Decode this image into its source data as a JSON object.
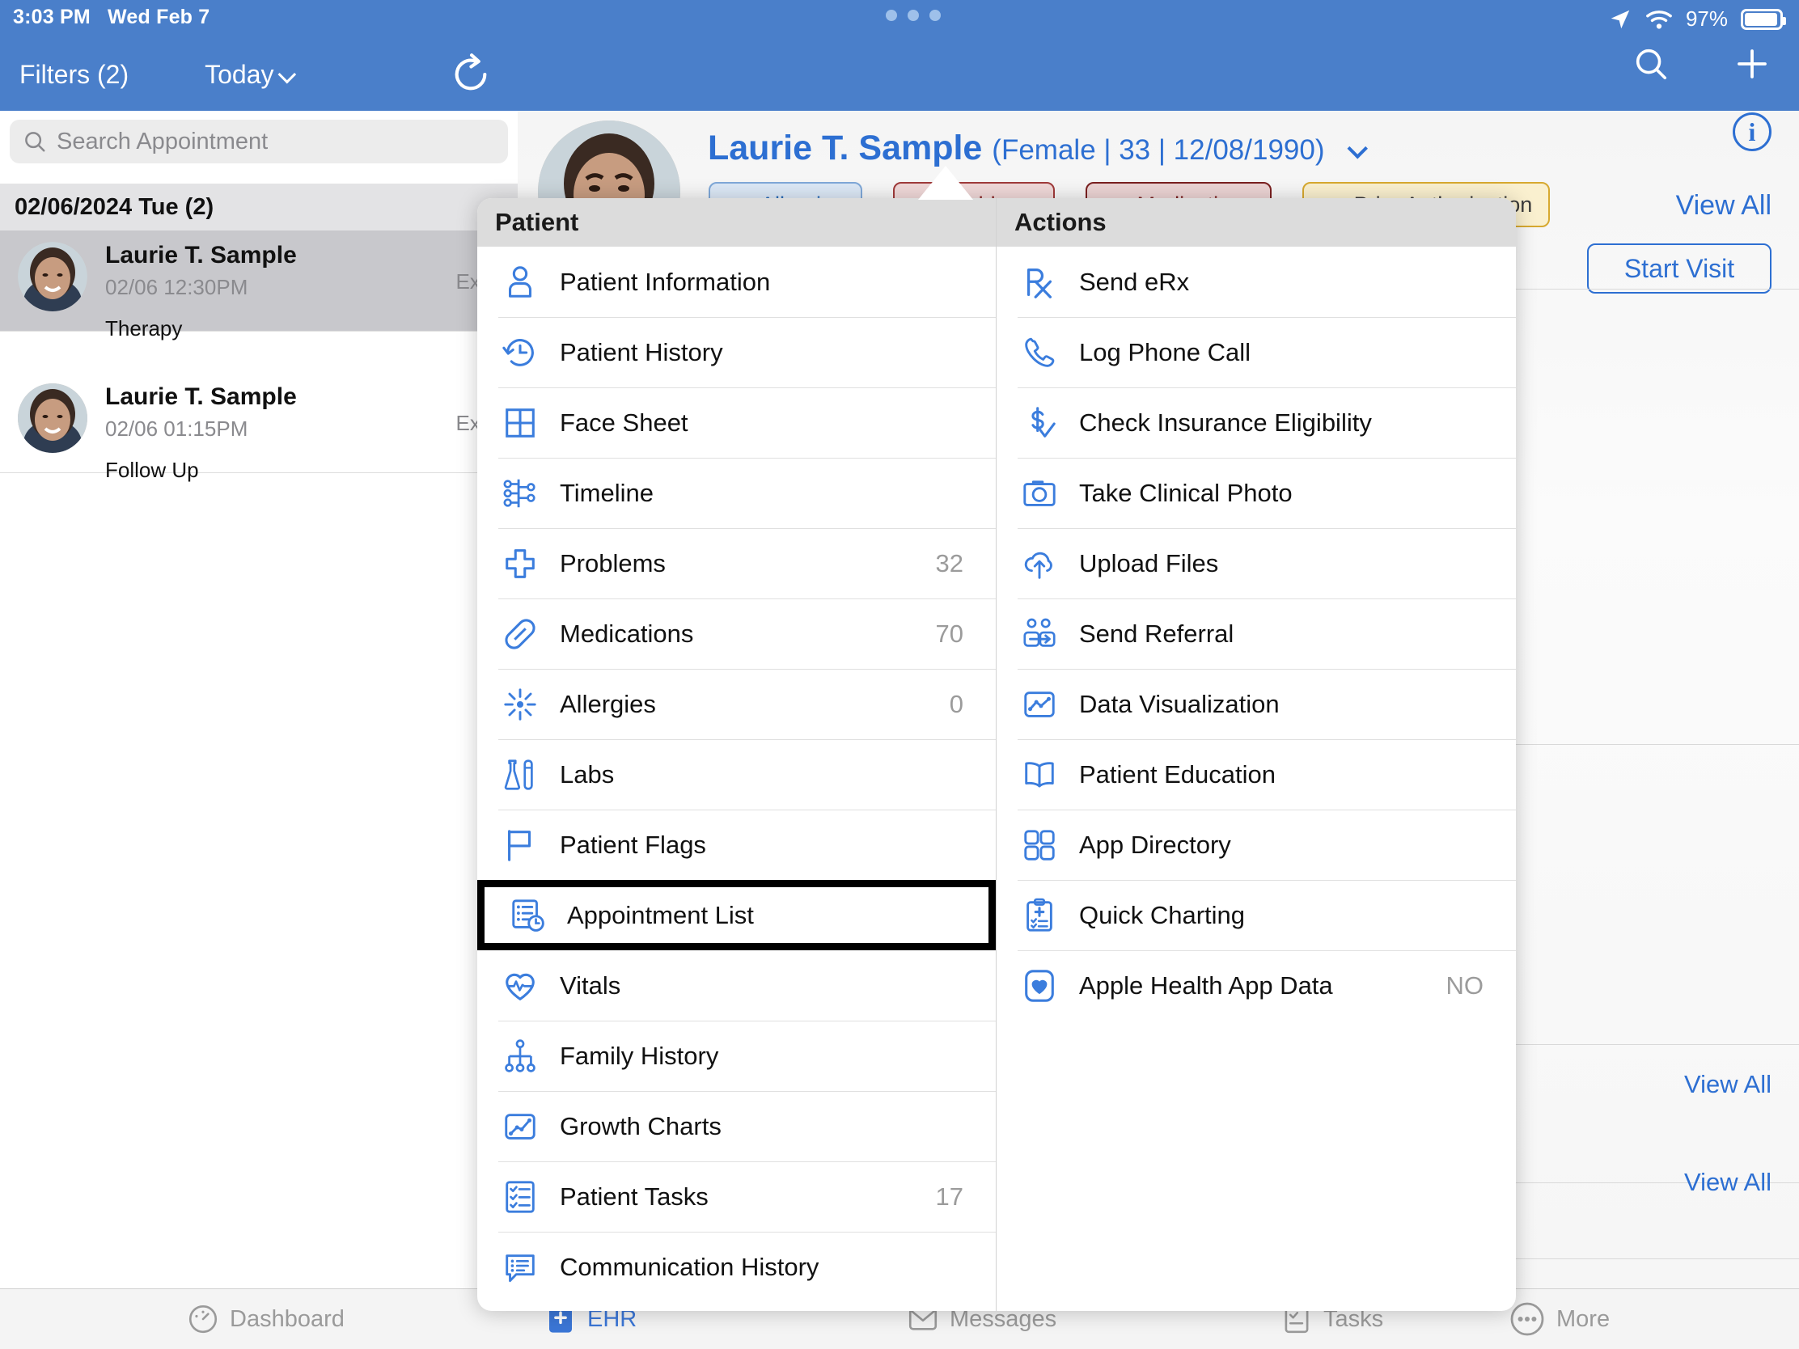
{
  "status_bar": {
    "time": "3:03 PM",
    "date": "Wed Feb 7",
    "battery_percent": "97%",
    "location_icon": "location-arrow-icon",
    "wifi_icon": "wifi-icon",
    "battery_icon": "battery-icon"
  },
  "left_pane": {
    "filters_label": "Filters (2)",
    "today_label": "Today",
    "refresh_icon": "refresh-icon",
    "search_placeholder": "Search Appointment",
    "search_icon": "search-icon",
    "day_header": "02/06/2024 Tue (2)",
    "appointments": [
      {
        "name": "Laurie T. Sample",
        "time": "02/06 12:30PM",
        "room": "Exam",
        "type": "Therapy",
        "selected": true
      },
      {
        "name": "Laurie T. Sample",
        "time": "02/06 01:15PM",
        "room": "Exam",
        "type": "Follow Up",
        "selected": false
      }
    ]
  },
  "top_nav": {
    "search_icon": "search-icon",
    "add_icon": "plus-icon",
    "drag_handle": "drag-dots-handle"
  },
  "patient_header": {
    "name": "Laurie T. Sample",
    "demographics": "(Female | 33 | 12/08/1990)",
    "chevron_icon": "chevron-down-icon",
    "info_icon": "info-icon",
    "view_all_label": "View All",
    "start_visit_label": "Start Visit",
    "chips": [
      {
        "label": "Allergies",
        "style": "blue"
      },
      {
        "label": "Problems",
        "style": "red"
      },
      {
        "label": "Medications",
        "style": "red2"
      },
      {
        "label": "Prior Authorization",
        "style": "gold"
      }
    ],
    "view_all_2": "View All",
    "view_all_3": "View All"
  },
  "popover": {
    "arrow_icon": "popover-arrow",
    "patient_column": {
      "title": "Patient",
      "items": [
        {
          "label": "Patient Information",
          "icon": "person-icon",
          "count": ""
        },
        {
          "label": "Patient History",
          "icon": "history-clock-icon",
          "count": ""
        },
        {
          "label": "Face Sheet",
          "icon": "grid-sheet-icon",
          "count": ""
        },
        {
          "label": "Timeline",
          "icon": "timeline-icon",
          "count": ""
        },
        {
          "label": "Problems",
          "icon": "medical-cross-icon",
          "count": "32"
        },
        {
          "label": "Medications",
          "icon": "pill-icon",
          "count": "70"
        },
        {
          "label": "Allergies",
          "icon": "allergy-burst-icon",
          "count": "0"
        },
        {
          "label": "Labs",
          "icon": "lab-flask-icon",
          "count": ""
        },
        {
          "label": "Patient Flags",
          "icon": "flag-icon",
          "count": ""
        },
        {
          "label": "Appointment List",
          "icon": "appointment-list-icon",
          "count": "",
          "highlighted": true
        },
        {
          "label": "Vitals",
          "icon": "heart-pulse-icon",
          "count": ""
        },
        {
          "label": "Family History",
          "icon": "family-tree-icon",
          "count": ""
        },
        {
          "label": "Growth Charts",
          "icon": "growth-chart-icon",
          "count": ""
        },
        {
          "label": "Patient Tasks",
          "icon": "checklist-icon",
          "count": "17"
        },
        {
          "label": "Communication History",
          "icon": "comm-history-icon",
          "count": ""
        }
      ]
    },
    "actions_column": {
      "title": "Actions",
      "items": [
        {
          "label": "Send eRx",
          "icon": "rx-icon",
          "count": ""
        },
        {
          "label": "Log Phone Call",
          "icon": "phone-icon",
          "count": ""
        },
        {
          "label": "Check Insurance Eligibility",
          "icon": "dollar-check-icon",
          "count": ""
        },
        {
          "label": "Take Clinical Photo",
          "icon": "camera-icon",
          "count": ""
        },
        {
          "label": "Upload Files",
          "icon": "cloud-upload-icon",
          "count": ""
        },
        {
          "label": "Send Referral",
          "icon": "referral-icon",
          "count": ""
        },
        {
          "label": "Data Visualization",
          "icon": "data-viz-icon",
          "count": ""
        },
        {
          "label": "Patient Education",
          "icon": "book-icon",
          "count": ""
        },
        {
          "label": "App Directory",
          "icon": "app-grid-icon",
          "count": ""
        },
        {
          "label": "Quick Charting",
          "icon": "clipboard-plus-icon",
          "count": ""
        },
        {
          "label": "Apple Health App Data",
          "icon": "heart-square-icon",
          "count": "NO"
        }
      ]
    }
  },
  "tab_bar": {
    "items": [
      {
        "label": "Dashboard",
        "icon": "gauge-icon",
        "active": false
      },
      {
        "label": "EHR",
        "icon": "ehr-icon",
        "active": true
      },
      {
        "label": "Messages",
        "icon": "messages-icon",
        "active": false
      },
      {
        "label": "Tasks",
        "icon": "tasks-icon",
        "active": false
      },
      {
        "label": "More",
        "icon": "more-dots-icon",
        "active": false
      }
    ]
  },
  "colors": {
    "header_blue": "#4a7fca",
    "accent_blue": "#2d6fd2",
    "icon_blue": "#3b7ddd",
    "highlight_border": "#000000",
    "muted_text": "#9b9b9b"
  }
}
